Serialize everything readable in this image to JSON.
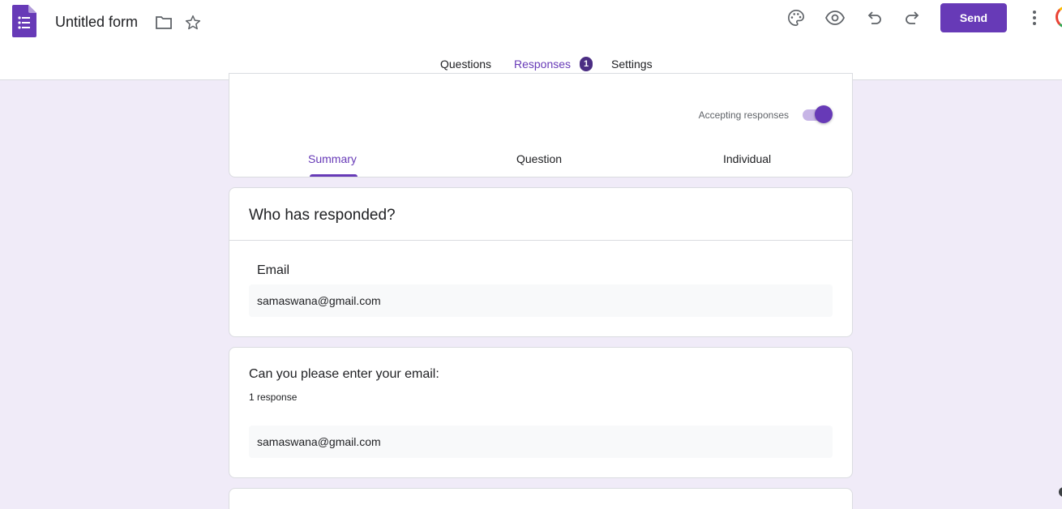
{
  "header": {
    "title": "Untitled form",
    "send_label": "Send",
    "colors": {
      "accent": "#673ab7",
      "background": "#f0ebf8"
    },
    "icons": [
      "forms-logo-icon",
      "folder-icon",
      "star-icon",
      "palette-icon",
      "preview-eye-icon",
      "undo-icon",
      "redo-icon",
      "more-vert-icon"
    ]
  },
  "tabs": [
    {
      "label": "Questions"
    },
    {
      "label": "Responses",
      "badge": "1"
    },
    {
      "label": "Settings"
    }
  ],
  "summary": {
    "accepting_label": "Accepting responses",
    "accepting_on": true,
    "subtabs": [
      "Summary",
      "Question",
      "Individual"
    ]
  },
  "who_responded": {
    "heading": "Who has responded?",
    "field_label": "Email",
    "value": "samaswana@gmail.com"
  },
  "question": {
    "text": "Can you please enter your email:",
    "count": "1 response",
    "answer": "samaswana@gmail.com"
  }
}
